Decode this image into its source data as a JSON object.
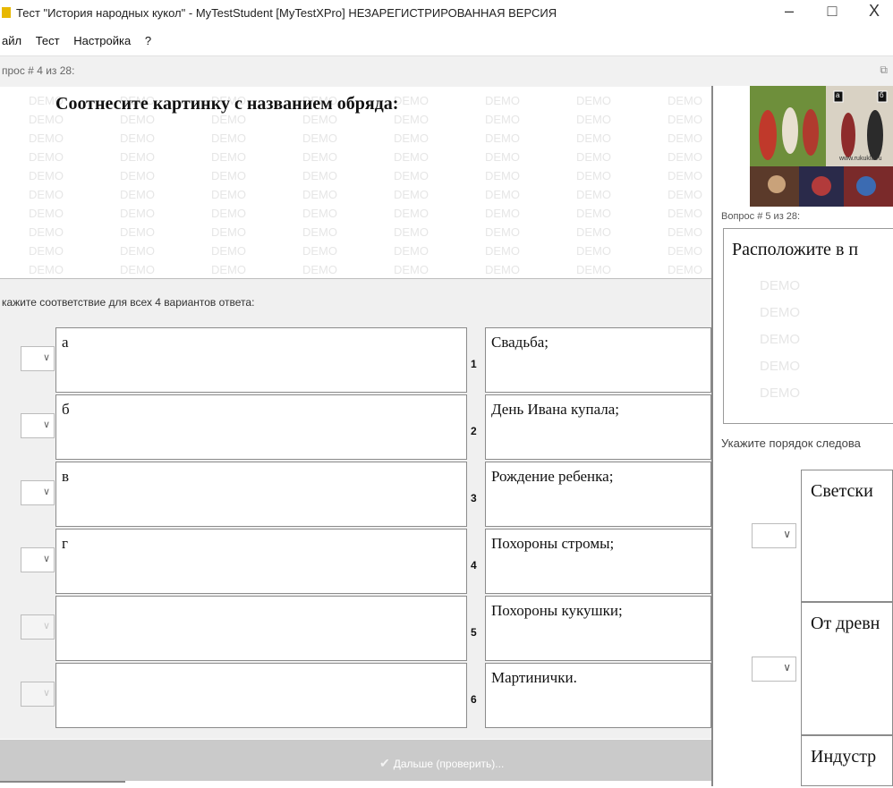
{
  "window": {
    "title": "Тест \"История народных кукол\" - MyTestStudent [MyTestXPro] НЕЗАРЕГИСТРИРОВАННАЯ ВЕРСИЯ",
    "minimize": "–",
    "maximize": "□",
    "close": "X"
  },
  "menu": [
    "айл",
    "Тест",
    "Настройка",
    "?"
  ],
  "question_bar": {
    "label": "прос # 4 из 28:"
  },
  "question": {
    "title": "Соотнесите картинку с названием обряда:",
    "watermark": "DEMO"
  },
  "instruction": "кажите соответствие для всех 4 вариантов ответа:",
  "left_items": [
    "а",
    "б",
    "в",
    "г",
    "",
    ""
  ],
  "right_items": [
    {
      "num": "1",
      "text": "Свадьба;"
    },
    {
      "num": "2",
      "text": "День Ивана купала;"
    },
    {
      "num": "3",
      "text": "Рождение ребенка;"
    },
    {
      "num": "4",
      "text": "Похороны стромы;"
    },
    {
      "num": "5",
      "text": "Похороны кукушки;"
    },
    {
      "num": "6",
      "text": "Мартинички."
    }
  ],
  "dropdown_states": [
    "enabled",
    "enabled",
    "enabled",
    "enabled",
    "disabled",
    "disabled"
  ],
  "next_button": "Дальше (проверить)...",
  "second_window": {
    "question_label": "Вопрос # 5 из 28:",
    "question_text": "Расположите в п",
    "instruction": "Укажите порядок следова",
    "items": [
      "Светски",
      "От древн",
      "Индустр"
    ],
    "thumb_labels": [
      "а",
      "б"
    ],
    "thumb_caption": "www.rukukla.ru"
  },
  "colors": {
    "footer": "#cacaca",
    "panel": "#f0f0f0",
    "watermark": "#e6e6e6"
  }
}
